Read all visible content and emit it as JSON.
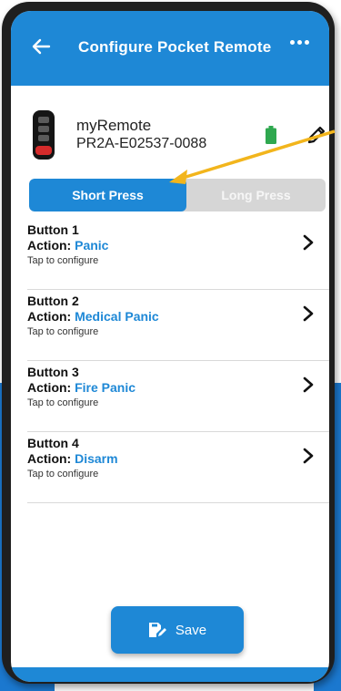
{
  "header": {
    "title": "Configure Pocket Remote",
    "back_icon": "arrow-left-icon",
    "menu_icon": "more-horizontal-icon"
  },
  "device": {
    "name": "myRemote",
    "serial": "PR2A-E02537-0088",
    "battery_color": "#2fa84f",
    "edit_icon": "pencil-icon"
  },
  "press_toggle": {
    "options": [
      "Short Press",
      "Long Press"
    ],
    "selected": "Short Press"
  },
  "buttons": [
    {
      "title": "Button 1",
      "action_label": "Action:",
      "action": "Panic",
      "hint": "Tap to configure"
    },
    {
      "title": "Button 2",
      "action_label": "Action:",
      "action": "Medical Panic",
      "hint": "Tap to configure"
    },
    {
      "title": "Button 3",
      "action_label": "Action:",
      "action": "Fire Panic",
      "hint": "Tap to configure"
    },
    {
      "title": "Button 4",
      "action_label": "Action:",
      "action": "Disarm",
      "hint": "Tap to configure"
    }
  ],
  "save": {
    "label": "Save",
    "icon": "save-edit-icon"
  },
  "colors": {
    "primary": "#1e88d6",
    "annotation_arrow": "#f2b51c"
  }
}
